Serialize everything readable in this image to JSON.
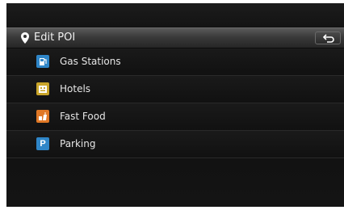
{
  "header": {
    "title": "Edit POI",
    "pin_icon": "map-pin-icon",
    "back_icon": "back-arrow-icon"
  },
  "poi_items": [
    {
      "label": "Gas Stations",
      "icon": "gas-pump-icon",
      "color": "#2f86c8"
    },
    {
      "label": "Hotels",
      "icon": "hotel-icon",
      "color": "#c9a52a"
    },
    {
      "label": "Fast Food",
      "icon": "fast-food-icon",
      "color": "#e07826"
    },
    {
      "label": "Parking",
      "icon": "parking-icon",
      "icon_text": "P",
      "color": "#2f86c8"
    }
  ]
}
